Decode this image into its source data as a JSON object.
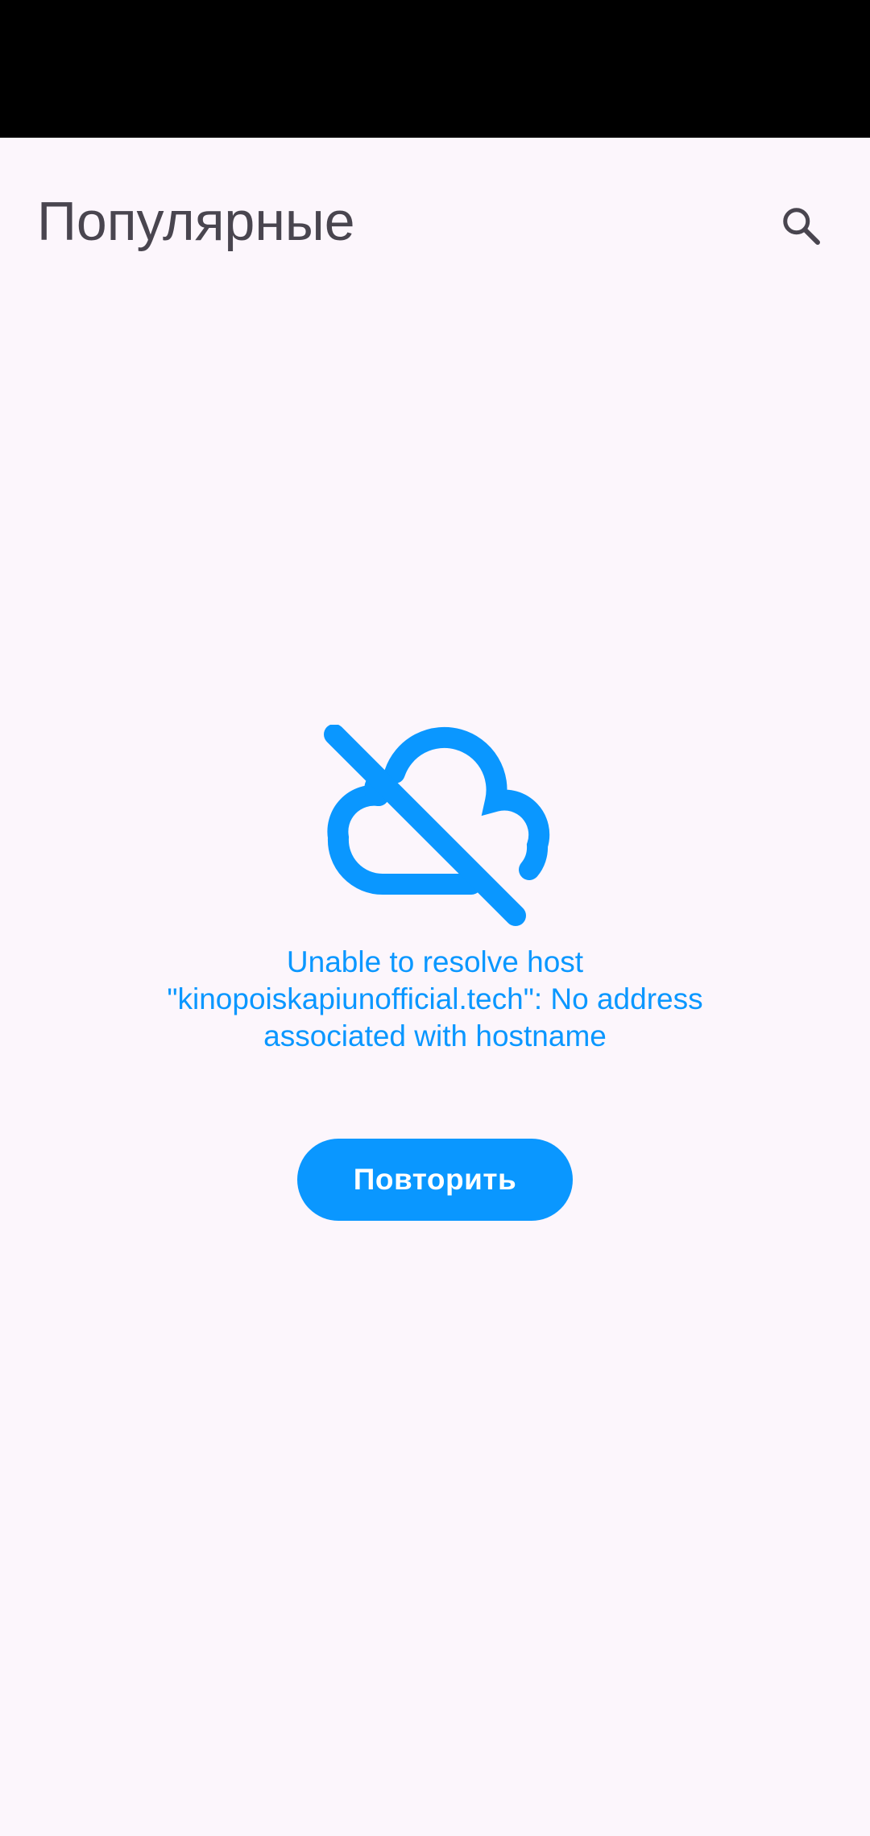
{
  "header": {
    "title": "Популярные",
    "search_icon": "search-icon"
  },
  "error": {
    "icon": "cloud-off-icon",
    "message": "Unable to resolve host \"kinopoiskapiunofficial.tech\": No address associated with hostname",
    "retry_label": "Повторить"
  },
  "colors": {
    "background": "#FCF6FC",
    "status_bar": "#000000",
    "title": "#49454F",
    "accent": "#0A97FF",
    "button_text": "#FFFFFF"
  }
}
